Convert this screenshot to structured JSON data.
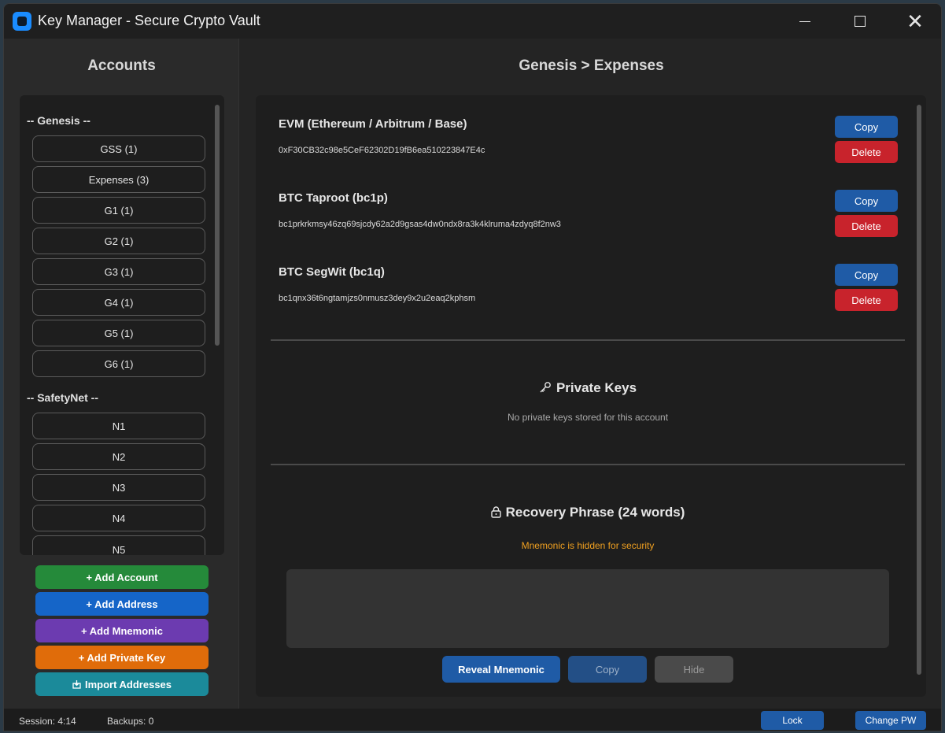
{
  "window": {
    "title": "Key Manager - Secure Crypto Vault"
  },
  "sidebar": {
    "title": "Accounts",
    "groups": [
      {
        "name": "-- Genesis --",
        "accounts": [
          "GSS (1)",
          "Expenses (3)",
          "G1 (1)",
          "G2 (1)",
          "G3 (1)",
          "G4 (1)",
          "G5 (1)",
          "G6 (1)"
        ]
      },
      {
        "name": "-- SafetyNet --",
        "accounts": [
          "N1",
          "N2",
          "N3",
          "N4",
          "N5"
        ]
      }
    ],
    "actions": {
      "add_account": "+ Add Account",
      "add_address": "+ Add Address",
      "add_mnemonic": "+ Add Mnemonic",
      "add_private_key": "+ Add Private Key",
      "import_addresses": "Import Addresses"
    }
  },
  "main": {
    "breadcrumb": "Genesis > Expenses",
    "addresses": [
      {
        "label": "EVM (Ethereum / Arbitrum / Base)",
        "value": "0xF30CB32c98e5CeF62302D19fB6ea510223847E4c"
      },
      {
        "label": "BTC Taproot (bc1p)",
        "value": "bc1prkrkmsy46zq69sjcdy62a2d9gsas4dw0ndx8ra3k4klruma4zdyq8f2nw3"
      },
      {
        "label": "BTC SegWit (bc1q)",
        "value": "bc1qnx36t6ngtamjzs0nmusz3dey9x2u2eaq2kphsm"
      }
    ],
    "copy_label": "Copy",
    "delete_label": "Delete",
    "private_keys": {
      "title": "Private Keys",
      "empty": "No private keys stored for this account"
    },
    "recovery": {
      "title": "Recovery Phrase (24 words)",
      "hidden_notice": "Mnemonic is hidden for security",
      "reveal": "Reveal Mnemonic",
      "copy": "Copy",
      "hide": "Hide"
    }
  },
  "status": {
    "session": "Session: 4:14",
    "backups": "Backups: 0",
    "lock": "Lock",
    "change_pw": "Change PW"
  },
  "colors": {
    "add_account": "#258a3a",
    "add_address": "#1565c8",
    "add_mnemonic": "#6c3bb0",
    "add_private_key": "#e06c0a",
    "import_addresses": "#1b8a9a",
    "accent": "#1f5ba6",
    "danger": "#c8232c",
    "warning": "#f0a020"
  },
  "icons": [
    "window-app-icon",
    "minimize-icon",
    "maximize-icon",
    "close-icon",
    "key-icon",
    "lock-icon",
    "import-icon"
  ]
}
